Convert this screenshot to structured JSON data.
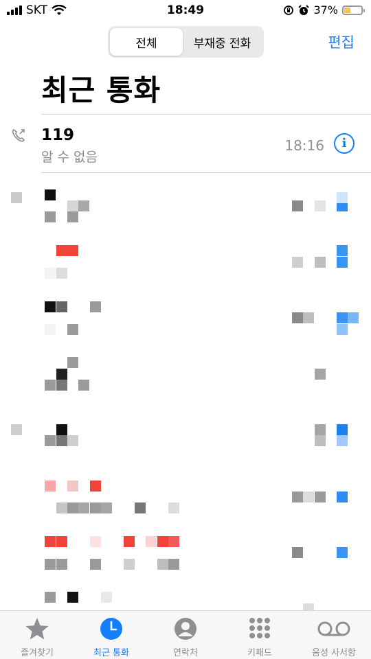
{
  "status_bar": {
    "carrier": "SKT",
    "time": "18:49",
    "battery": "37%",
    "battery_level": 0.37,
    "battery_color": "#f6c744"
  },
  "header": {
    "segments": [
      {
        "label": "전체",
        "selected": true
      },
      {
        "label": "부재중 전화",
        "selected": false
      }
    ],
    "edit_label": "편집",
    "title": "최근 통화"
  },
  "recents": [
    {
      "name": "119",
      "subtitle": "알 수 없음",
      "time": "18:16",
      "icon": "outgoing-phone-icon"
    }
  ],
  "tabs": [
    {
      "label": "즐겨찾기",
      "icon": "star-icon",
      "active": false
    },
    {
      "label": "최근 통화",
      "icon": "clock-icon",
      "active": true
    },
    {
      "label": "연락처",
      "icon": "contact-icon",
      "active": false
    },
    {
      "label": "키패드",
      "icon": "keypad-icon",
      "active": false
    },
    {
      "label": "음성 사서함",
      "icon": "voicemail-icon",
      "active": false
    }
  ],
  "colors": {
    "accent": "#157efb",
    "secondary_text": "#8e8e93"
  }
}
